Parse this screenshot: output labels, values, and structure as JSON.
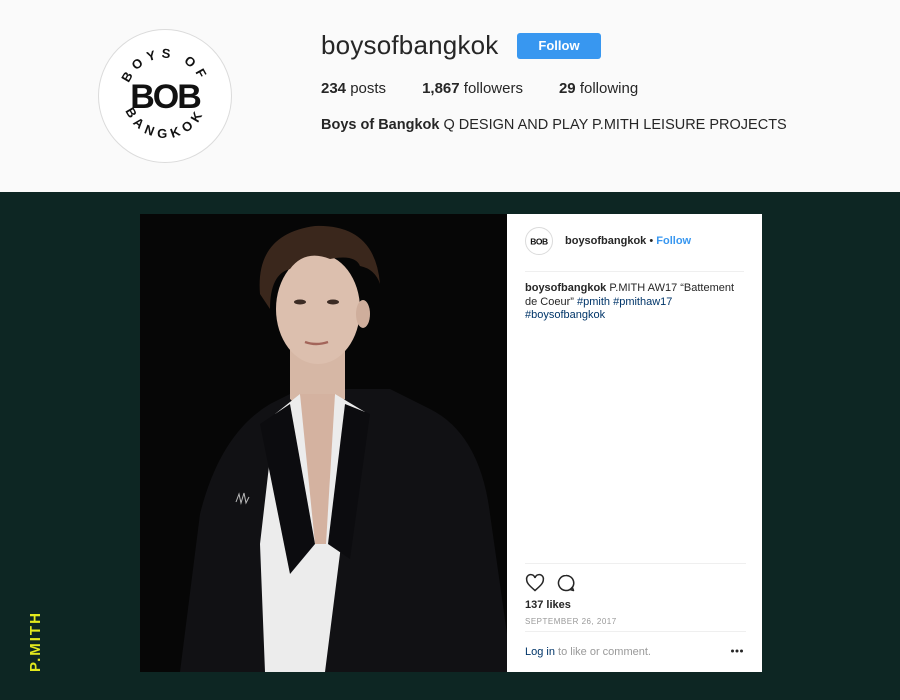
{
  "profile": {
    "username": "boysofbangkok",
    "follow_label": "Follow",
    "stats": {
      "posts_count": "234",
      "posts_label": " posts",
      "followers_count": "1,867",
      "followers_label": " followers",
      "following_count": "29",
      "following_label": " following"
    },
    "bio": {
      "name": "Boys of Bangkok",
      "text": " Q DESIGN AND PLAY P.MITH LEISURE PROJECTS"
    },
    "logo": {
      "top_text": "BOYS OF",
      "center_text": "BOB",
      "bottom_text": "BANGKOK"
    }
  },
  "post": {
    "username": "boysofbangkok",
    "dot": " • ",
    "follow_label": "Follow",
    "caption": {
      "user": "boysofbangkok",
      "text": " P.MITH AW17 “Battement de Coeur” ",
      "tags": [
        "#pmith",
        "#pmithaw17",
        "#boysofbangkok"
      ]
    },
    "likes": "137 likes",
    "date": "SEPTEMBER 26, 2017",
    "comment": {
      "login_label": "Log in",
      "rest": " to like or comment."
    }
  },
  "icons": {
    "like": "heart-icon",
    "comment": "speech-bubble-icon",
    "more": "ellipsis-icon"
  },
  "side_label": "P.MITH",
  "colors": {
    "background": "#0d2623",
    "header_bg": "#fafafa",
    "accent_blue": "#3897f0",
    "side_label": "#e2e91d"
  }
}
